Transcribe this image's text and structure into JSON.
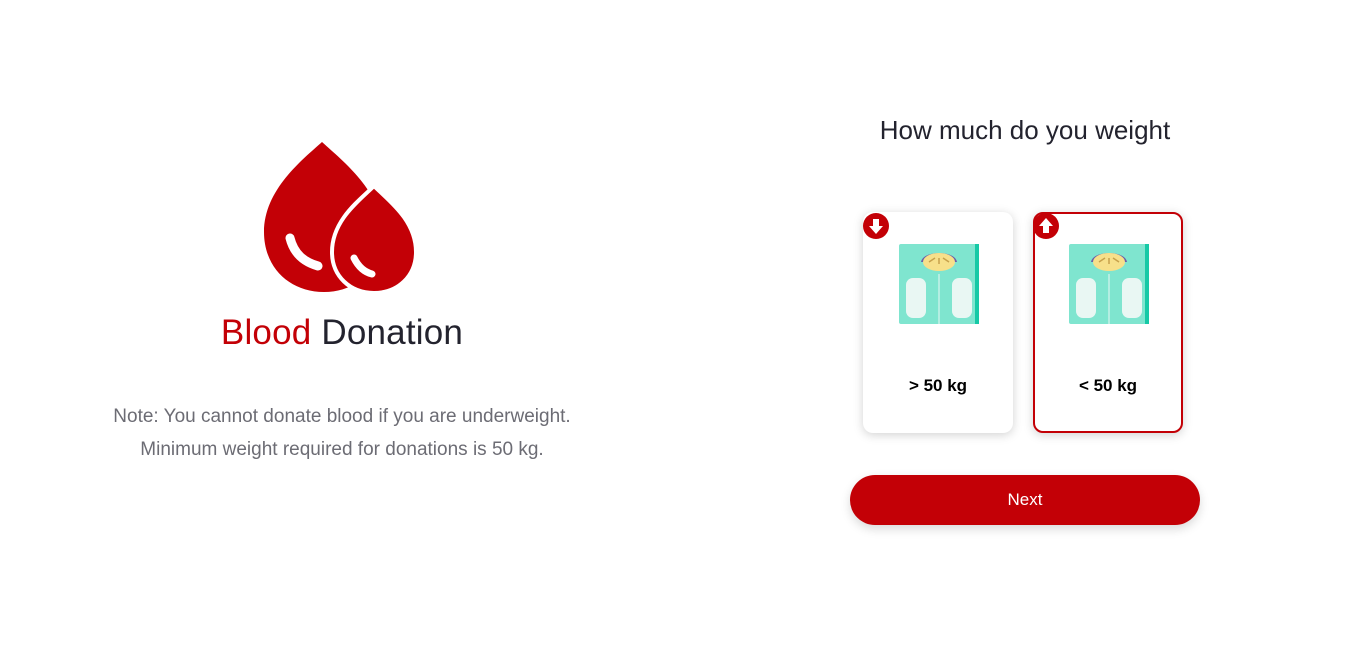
{
  "brand": {
    "accent_word": "Blood",
    "rest_word": "Donation"
  },
  "note": "Note: You cannot donate blood if you are underweight. Minimum weight required for donations is 50 kg.",
  "question": "How much do you weight",
  "options": [
    {
      "label": "> 50 kg",
      "badge_icon": "arrow-down-icon",
      "selected": false
    },
    {
      "label": "< 50 kg",
      "badge_icon": "arrow-up-icon",
      "selected": true
    }
  ],
  "next_label": "Next",
  "colors": {
    "brand_red": "#c30006",
    "text_dark": "#23232e",
    "note_gray": "#6c6c74",
    "scale_teal": "#7fe5cf"
  }
}
